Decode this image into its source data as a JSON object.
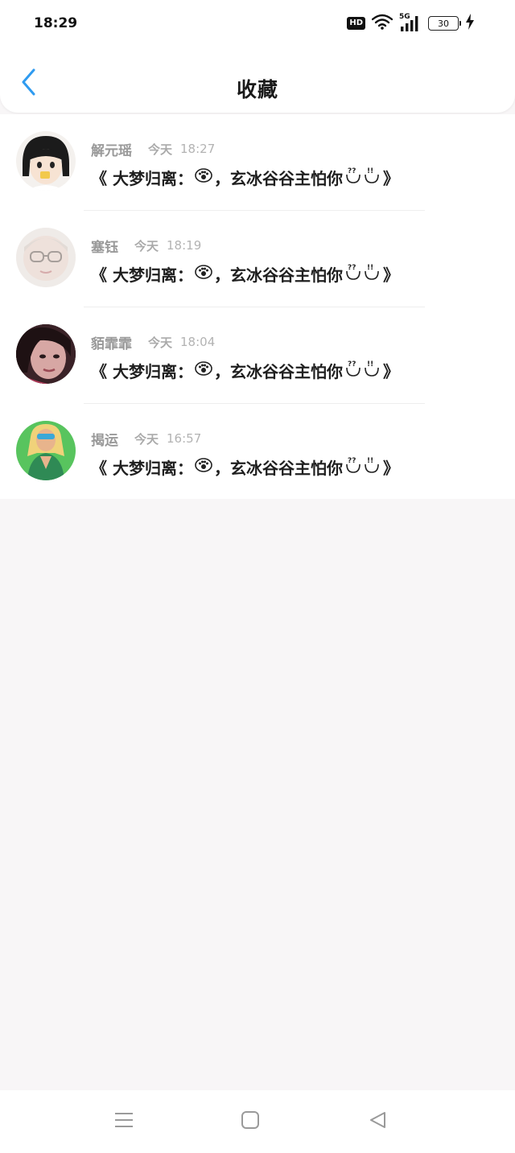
{
  "status_bar": {
    "time": "18:29",
    "hd_label": "HD",
    "network_label": "5G",
    "battery_level": "30"
  },
  "header": {
    "title": "收藏"
  },
  "favorites": [
    {
      "sender": "解元瑶",
      "day": "今天",
      "time": "18:27",
      "message_prefix": "《 大梦归离：",
      "message_suffix": "，玄冰谷谷主怕你",
      "message_end": "》"
    },
    {
      "sender": "塞钰",
      "day": "今天",
      "time": "18:19",
      "message_prefix": "《 大梦归离：",
      "message_suffix": "，玄冰谷谷主怕你",
      "message_end": "》"
    },
    {
      "sender": "貊霏霏",
      "day": "今天",
      "time": "18:04",
      "message_prefix": "《 大梦归离：",
      "message_suffix": "，玄冰谷谷主怕你",
      "message_end": "》"
    },
    {
      "sender": "揭运",
      "day": "今天",
      "time": "16:57",
      "message_prefix": "《 大梦归离：",
      "message_suffix": "，玄冰谷谷主怕你",
      "message_end": "》"
    }
  ],
  "icons": {
    "back": "chevron-left-icon",
    "menu": "menu-icon",
    "home": "home-square-icon",
    "back_nav": "triangle-back-icon"
  },
  "colors": {
    "accent": "#2f9bf0",
    "page_bg": "#f8f6f7"
  }
}
